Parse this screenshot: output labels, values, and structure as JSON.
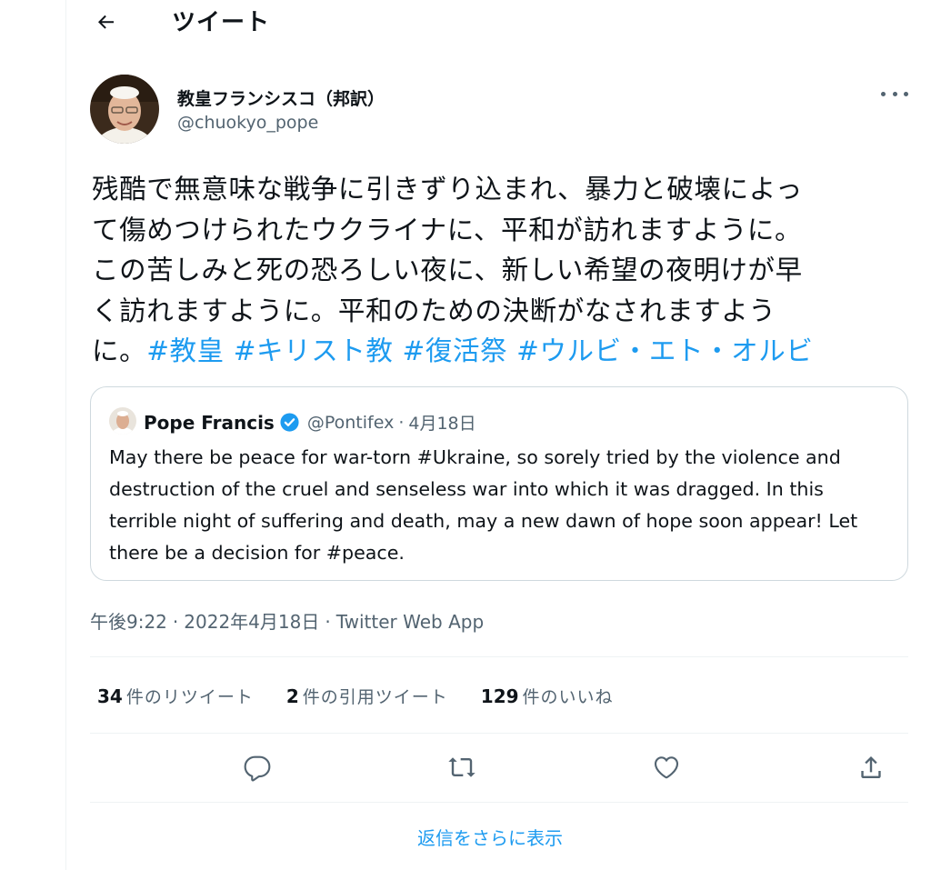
{
  "header": {
    "title": "ツイート"
  },
  "author": {
    "name": "教皇フランシスコ（邦訳）",
    "handle": "@chuokyo_pope"
  },
  "tweet": {
    "lines": [
      "残酷で無意味な戦争に引きずり込まれ、暴力と破壊によっ",
      "て傷めつけられたウクライナに、平和が訪れますように。",
      "この苦しみと死の恐ろしい夜に、新しい希望の夜明けが早",
      "く訪れますように。平和のための決断がなされますよう"
    ],
    "last_line_start": "に。",
    "hashtags": [
      "#教皇",
      "#キリスト教",
      "#復活祭",
      "#ウルビ・エト・オルビ"
    ]
  },
  "quote": {
    "name": "Pope Francis",
    "handle": "@Pontifex",
    "separator": "·",
    "date": "4月18日",
    "lines": [
      "May there be peace for war-torn #Ukraine, so sorely tried by the violence and",
      "destruction of the cruel and senseless war into which it was dragged. In this",
      "terrible night of suffering and death, may a new dawn of hope soon appear! Let",
      "there be a decision for #peace."
    ]
  },
  "meta": {
    "time": "午後9:22",
    "date": "2022年4月18日",
    "separator": "·",
    "source": "Twitter Web App"
  },
  "stats": {
    "retweets": {
      "count": "34",
      "label": "件のリツイート"
    },
    "quotes": {
      "count": "2",
      "label": "件の引用ツイート"
    },
    "likes": {
      "count": "129",
      "label": "件のいいね"
    }
  },
  "actions": {
    "reply": "reply-icon",
    "retweet": "retweet-icon",
    "like": "heart-icon",
    "share": "share-icon"
  },
  "show_more": "返信をさらに表示",
  "colors": {
    "accent": "#1d9bf0",
    "secondary_text": "#536471",
    "border": "#cfd9de"
  }
}
